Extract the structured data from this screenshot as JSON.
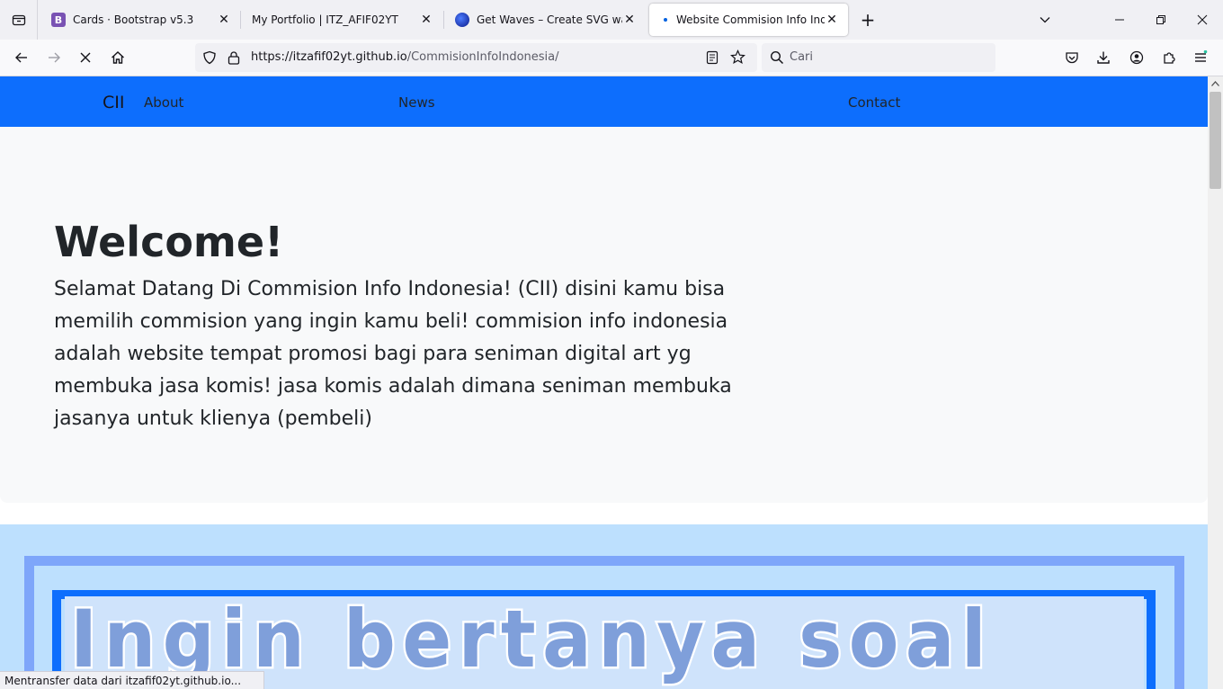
{
  "browser": {
    "tabs": [
      {
        "title": "Cards · Bootstrap v5.3",
        "favicon": "bootstrap-icon",
        "active": false
      },
      {
        "title": "My Portfolio | ITZ_AFIF02YT",
        "favicon": "none",
        "active": false
      },
      {
        "title": "Get Waves – Create SVG waves f",
        "favicon": "getwaves-icon",
        "active": false
      },
      {
        "title": "Website Commision Info Indon",
        "favicon": "loading-dot",
        "active": true
      }
    ],
    "url_host": "https://itzafif02yt.github.io",
    "url_path": "/CommisionInfoIndonesia/",
    "search_placeholder": "Cari",
    "status_text": "Mentransfer data dari itzafif02yt.github.io..."
  },
  "site": {
    "brand": "CII",
    "nav": {
      "about": "About",
      "news": "News",
      "contact": "Contact"
    },
    "hero": {
      "title": "Welcome!",
      "text": "Selamat Datang Di Commision Info Indonesia! (CII) disini kamu bisa memilih commision yang ingin kamu beli! commision info indonesia adalah website tempat promosi bagi para seniman digital art yg membuka jasa komis! jasa komis adalah dimana seniman membuka jasanya untuk klienya (pembeli)"
    },
    "banner_text": "Ingin bertanya soal"
  },
  "colors": {
    "primary": "#0d6efd",
    "hero_bg": "#f8f9fa",
    "band_bg": "#bde0fe",
    "frame_outer": "#7ea6fa",
    "banner_text_fill": "#7f9fda"
  }
}
